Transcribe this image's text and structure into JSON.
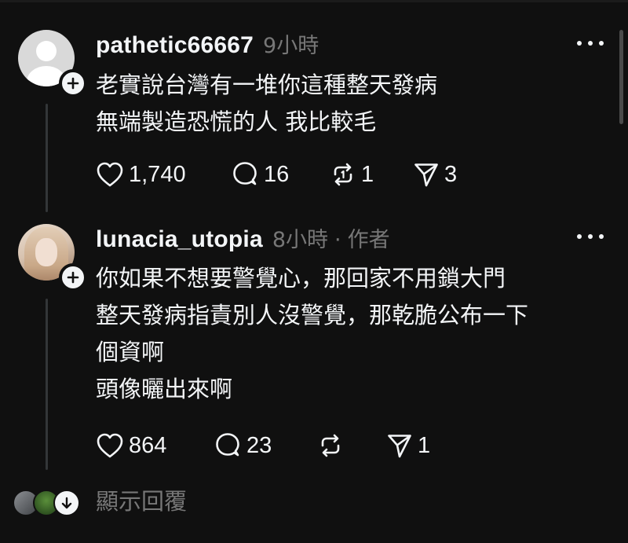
{
  "posts": [
    {
      "username": "pathetic66667",
      "timestamp": "9小時",
      "author_tag": "",
      "avatar": "default-avatar",
      "lines": [
        "老實說台灣有一堆你這種整天發病",
        "無端製造恐慌的人 我比較毛"
      ],
      "likes": "1,740",
      "comments": "16",
      "reposts": "1",
      "shares": "3"
    },
    {
      "username": "lunacia_utopia",
      "timestamp": "8小時",
      "separator": "·",
      "author_tag": "作者",
      "avatar": "photo-avatar",
      "lines": [
        "你如果不想要警覺心，那回家不用鎖大門",
        "整天發病指責別人沒警覺，那乾脆公布一下",
        "個資啊",
        "頭像曬出來啊"
      ],
      "likes": "864",
      "comments": "23",
      "reposts": "",
      "shares": "1"
    }
  ],
  "replies_link": "顯示回覆",
  "icons": {
    "like": "heart-icon",
    "comment": "speech-bubble-icon",
    "repost": "repost-arrows-icon",
    "share": "paper-plane-icon",
    "more": "more-dots-icon",
    "follow": "plus-icon",
    "expand": "arrow-down-icon"
  },
  "colors": {
    "background": "#101010",
    "text": "#f3f5f7",
    "secondary_text": "#777777",
    "thread_line": "#333638"
  }
}
